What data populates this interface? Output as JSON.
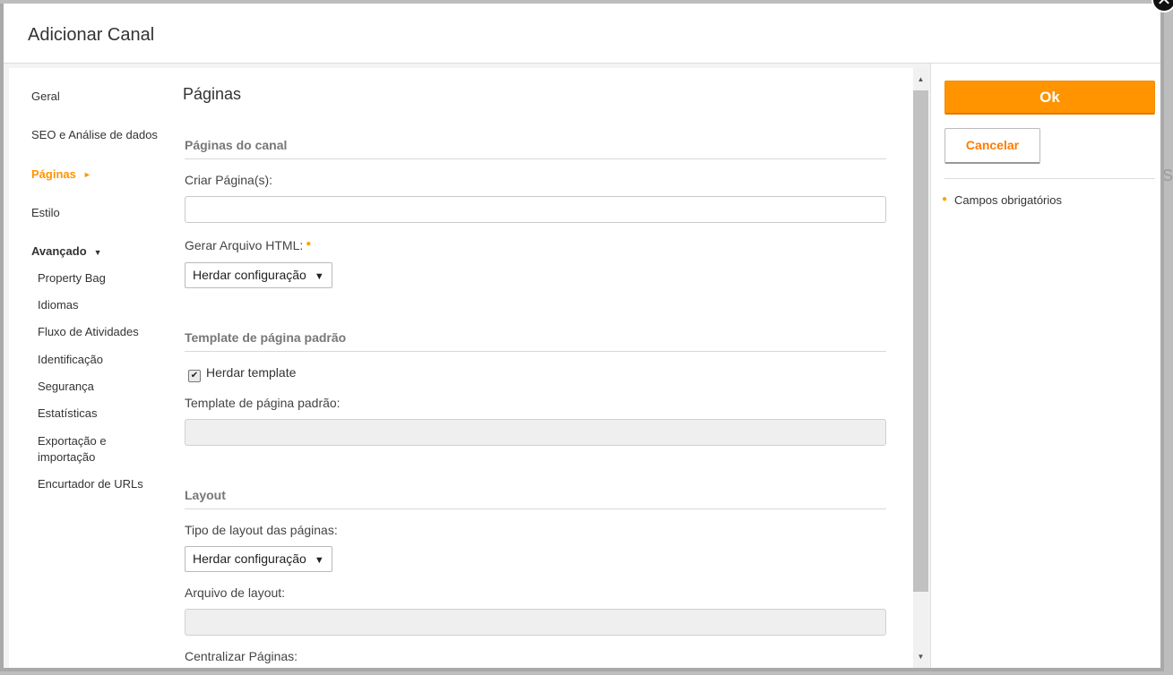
{
  "dialog": {
    "title": "Adicionar Canal",
    "close_symbol": "✕"
  },
  "nav": {
    "items": [
      {
        "label": "Geral"
      },
      {
        "label": "SEO e Análise de dados"
      },
      {
        "label": "Páginas",
        "active": true,
        "arrow": "►"
      },
      {
        "label": "Estilo"
      }
    ],
    "advanced": {
      "label": "Avançado",
      "caret": "▼"
    },
    "sub_items": [
      {
        "label": "Property Bag"
      },
      {
        "label": "Idiomas"
      },
      {
        "label": "Fluxo de Atividades"
      },
      {
        "label": "Identificação"
      },
      {
        "label": "Segurança"
      },
      {
        "label": "Estatísticas"
      },
      {
        "label": "Exportação e importação"
      },
      {
        "label": "Encurtador de URLs"
      }
    ]
  },
  "form": {
    "heading": "Páginas",
    "section_channel_pages": "Páginas do canal",
    "create_pages_label": "Criar Página(s):",
    "create_pages_value": "",
    "generate_html_label": "Gerar Arquivo HTML:",
    "generate_html_value": "Herdar configuração",
    "section_default_template": "Template de página padrão",
    "inherit_template_label": "Herdar template",
    "inherit_template_checked": "✔",
    "default_template_label": "Template de página padrão:",
    "default_template_value": "",
    "section_layout": "Layout",
    "layout_type_label": "Tipo de layout das páginas:",
    "layout_type_value": "Herdar configuração",
    "layout_file_label": "Arquivo de layout:",
    "layout_file_value": "",
    "center_pages_label": "Centralizar Páginas:",
    "dropdown_symbol": "▼",
    "required_symbol": "●"
  },
  "actions": {
    "ok_label": "Ok",
    "cancel_label": "Cancelar",
    "required_note": "Campos obrigatórios"
  },
  "scrollbar": {
    "up": "▲",
    "down": "▼"
  },
  "colors": {
    "accent": "#ff9400",
    "required": "#ffa200"
  }
}
